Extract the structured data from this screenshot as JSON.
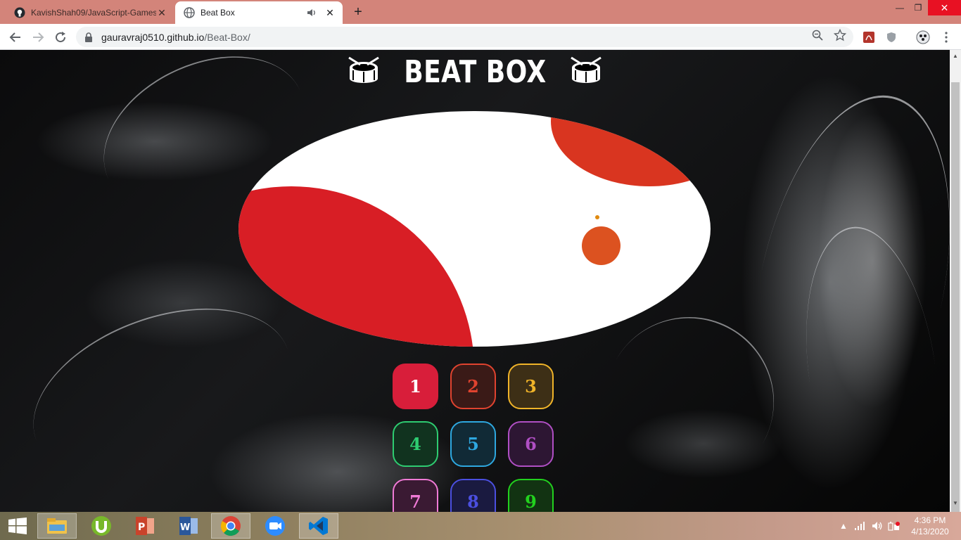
{
  "browser": {
    "tabs": [
      {
        "title": "KavishShah09/JavaScript-Games",
        "active": false
      },
      {
        "title": "Beat Box",
        "active": true
      }
    ],
    "url_host": "gauravraj0510.github.io",
    "url_path": "/Beat-Box/"
  },
  "page": {
    "heading": "BEAT BOX",
    "stage_colors": {
      "large_blob": "#d81e25",
      "top_blob": "#d93520",
      "small_blob": "#dc5220",
      "spark": "#e08a10"
    },
    "pads": [
      {
        "label": "1",
        "text_color": "#ffffff",
        "border": "#d81e3a",
        "bg": "#d81e3a"
      },
      {
        "label": "2",
        "text_color": "#e0432f",
        "border": "#e0432f",
        "bg": "#3a1a17"
      },
      {
        "label": "3",
        "text_color": "#f0b429",
        "border": "#f0b429",
        "bg": "#3d2f16"
      },
      {
        "label": "4",
        "text_color": "#2ecc71",
        "border": "#2ecc71",
        "bg": "#11331f"
      },
      {
        "label": "5",
        "text_color": "#2ea8e0",
        "border": "#2ea8e0",
        "bg": "#112a36"
      },
      {
        "label": "6",
        "text_color": "#b04fc4",
        "border": "#b04fc4",
        "bg": "#2d1633"
      },
      {
        "label": "7",
        "text_color": "#f07ad6",
        "border": "#f07ad6",
        "bg": "#3a1a33"
      },
      {
        "label": "8",
        "text_color": "#4b4fe0",
        "border": "#4b4fe0",
        "bg": "#1a1a40"
      },
      {
        "label": "9",
        "text_color": "#22d11e",
        "border": "#22d11e",
        "bg": "#123312"
      }
    ]
  },
  "taskbar": {
    "apps": [
      "file-explorer",
      "utorrent",
      "powerpoint",
      "word",
      "chrome",
      "zoom",
      "vscode"
    ],
    "time": "4:36 PM",
    "date": "4/13/2020"
  }
}
